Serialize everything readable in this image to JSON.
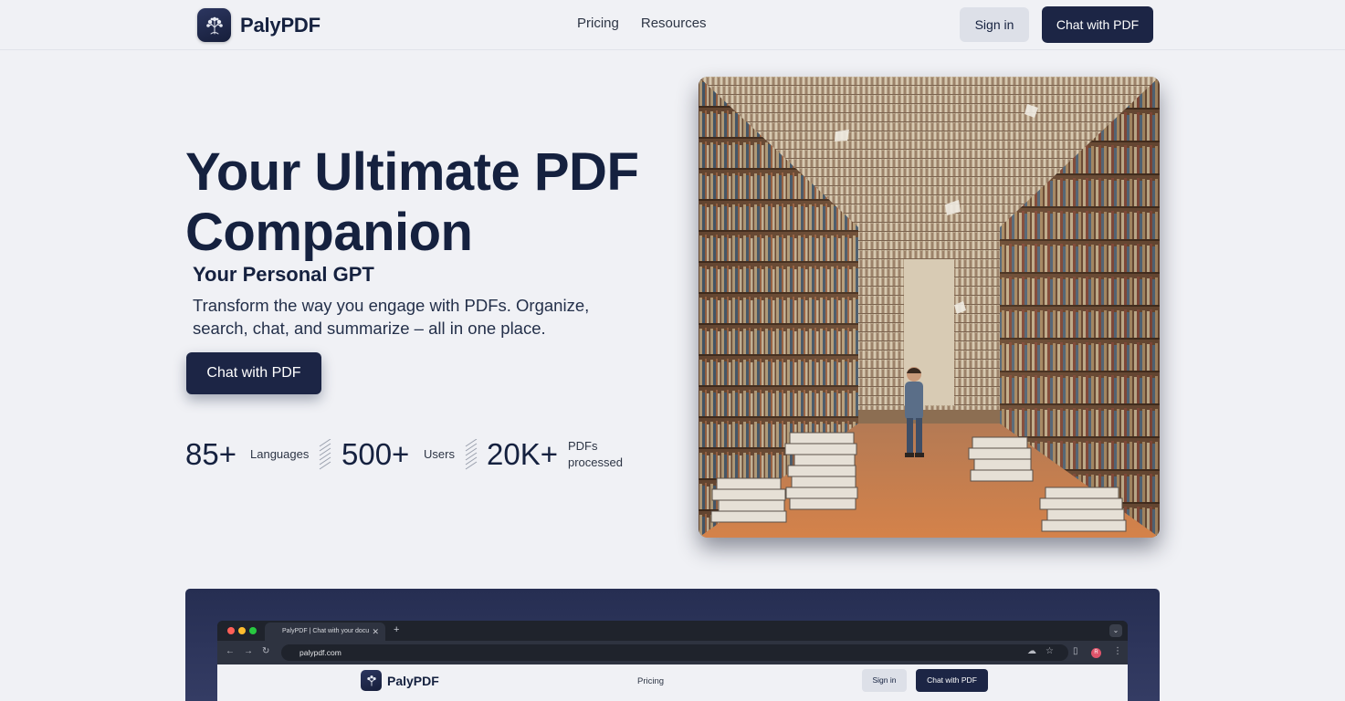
{
  "header": {
    "brand": "PalyPDF",
    "nav": [
      {
        "label": "Pricing"
      },
      {
        "label": "Resources"
      }
    ],
    "signin_label": "Sign in",
    "chat_label": "Chat with PDF"
  },
  "hero": {
    "title": "Your Ultimate PDF Companion",
    "subtitle": "Your Personal GPT",
    "description": "Transform the way you engage with PDFs. Organize, search, chat, and summarize – all in one place.",
    "cta_label": "Chat with PDF",
    "stats": [
      {
        "value": "85+",
        "label": "Languages"
      },
      {
        "value": "500+",
        "label": "Users"
      },
      {
        "value": "20K+",
        "label": "PDFs processed"
      }
    ],
    "image": "library-illustration"
  },
  "preview": {
    "tab_title": "PalyPDF | Chat with your docu",
    "url": "palypdf.com",
    "avatar_initial": "R",
    "page": {
      "brand": "PalyPDF",
      "pricing_label": "Pricing",
      "signin_label": "Sign in",
      "chat_label": "Chat with PDF"
    }
  },
  "colors": {
    "background": "#f0f1f5",
    "primary": "#1c2545",
    "text": "#15213f",
    "secondary_button": "#dde0e8"
  }
}
